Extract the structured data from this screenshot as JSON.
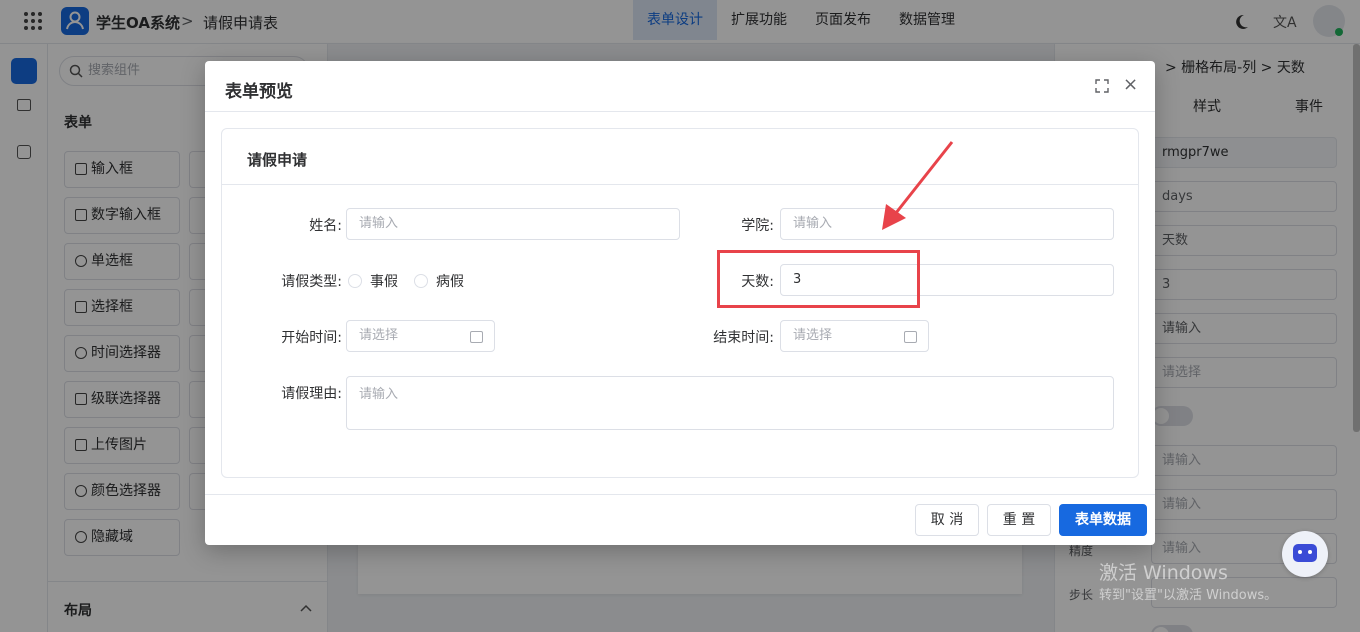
{
  "topbar": {
    "app_title": "学生OA系统",
    "crumb_sep": ">",
    "crumb": "请假申请表",
    "tabs": [
      "表单设计",
      "扩展功能",
      "页面发布",
      "数据管理"
    ],
    "active_tab": "表单设计",
    "translate_icon": "文A"
  },
  "left_panel": {
    "search_placeholder": "搜索组件",
    "form_section": "表单",
    "components": [
      "输入框",
      "数字输入框",
      "单选框",
      "选择框",
      "时间选择器",
      "级联选择器",
      "上传图片",
      "颜色选择器",
      "隐藏域"
    ],
    "layout_section": "布局"
  },
  "right_panel": {
    "breadcrumb": "> 栅格布局-列 > 天数",
    "tabs": [
      "样式",
      "事件"
    ],
    "fields": [
      "rmgpr7we",
      "days",
      "天数",
      "3",
      "请输入",
      "请选择",
      "请输入",
      "请输入",
      "请输入",
      ""
    ],
    "labels": {
      "precision": "精度",
      "step": "步长"
    }
  },
  "dialog": {
    "title": "表单预览",
    "close": "×",
    "card_title": "请假申请",
    "form": {
      "name_label": "姓名:",
      "name_placeholder": "请输入",
      "college_label": "学院:",
      "college_placeholder": "请输入",
      "type_label": "请假类型:",
      "type_options": [
        "事假",
        "病假"
      ],
      "days_label": "天数:",
      "days_value": "3",
      "start_label": "开始时间:",
      "start_placeholder": "请选择",
      "end_label": "结束时间:",
      "end_placeholder": "请选择",
      "reason_label": "请假理由:",
      "reason_placeholder": "请输入"
    },
    "buttons": {
      "cancel": "取 消",
      "reset": "重 置",
      "submit": "表单数据"
    }
  },
  "watermark": {
    "line1": "激活 Windows",
    "line2": "转到\"设置\"以激活 Windows。"
  },
  "colors": {
    "accent": "#1769e0",
    "highlight": "#e8434a"
  }
}
